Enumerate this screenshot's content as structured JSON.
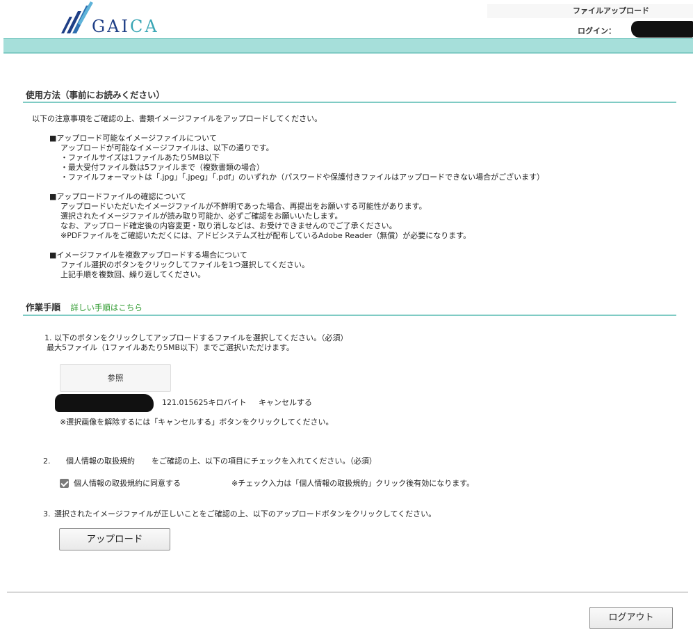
{
  "header": {
    "logo_text_1": "GAI",
    "logo_text_2": "CA",
    "page_title": "ファイルアップロード",
    "login_label": "ログイン："
  },
  "usage": {
    "heading": "使用方法（事前にお読みください）",
    "intro": "以下の注意事項をご確認の上、書類イメージファイルをアップロードしてください。",
    "block1": [
      "■アップロード可能なイメージファイルについて",
      "アップロードが可能なイメージファイルは、以下の通りです。",
      "・ファイルサイズは1ファイルあたり5MB以下",
      "・最大受付ファイル数は5ファイルまで（複数書類の場合）",
      "・ファイルフォーマットは「.jpg」「.jpeg」「.pdf」のいずれか（パスワードや保護付きファイルはアップロードできない場合がございます）"
    ],
    "block2": [
      "■アップロードファイルの確認について",
      "アップロードいただいたイメージファイルが不鮮明であった場合、再提出をお願いする可能性があります。",
      "選択されたイメージファイルが読み取り可能か、必ずご確認をお願いいたします。",
      "なお、アップロード確定後の内容変更・取り消しなどは、お受けできませんのでご了承ください。",
      "※PDFファイルをご確認いただくには、アドビシステムズ社が配布しているAdobe Reader（無償）が必要になります。"
    ],
    "block3": [
      "■イメージファイルを複数アップロードする場合について",
      "ファイル選択のボタンをクリックしてファイルを1つ選択してください。",
      "上記手順を複数回、繰り返してください。"
    ]
  },
  "steps": {
    "heading": "作業手順",
    "detail_link": "詳しい手順はこちら",
    "step1_num": "1.",
    "step1_line1": "以下のボタンをクリックしてアップロードするファイルを選択してください。（必須）",
    "step1_line2": "最大5ファイル（1ファイルあたり5MB以下）までご選択いただけます。",
    "browse_label": "参照",
    "file_size": "121.015625キロバイト",
    "cancel_link": "キャンセルする",
    "cancel_note": "※選択画像を解除するには「キャンセルする」ボタンをクリックしてください。",
    "step2_num": "2.",
    "step2_link": "個人情報の取扱規約",
    "step2_text": "をご確認の上、以下の項目にチェックを入れてください。（必須）",
    "agree_label": "個人情報の取扱規約に同意する",
    "agree_note": "※チェック入力は「個人情報の取扱規約」クリック後有効になります。",
    "agree_checked": true,
    "step3_num": "3.",
    "step3_text": "選択されたイメージファイルが正しいことをご確認の上、以下のアップロードボタンをクリックしてください。",
    "upload_label": "アップロード"
  },
  "footer": {
    "logout_label": "ログアウト"
  },
  "colors": {
    "accent_teal": "#a6dfda",
    "link_green": "#2e9a2e",
    "logo_navy": "#1f3f86"
  }
}
